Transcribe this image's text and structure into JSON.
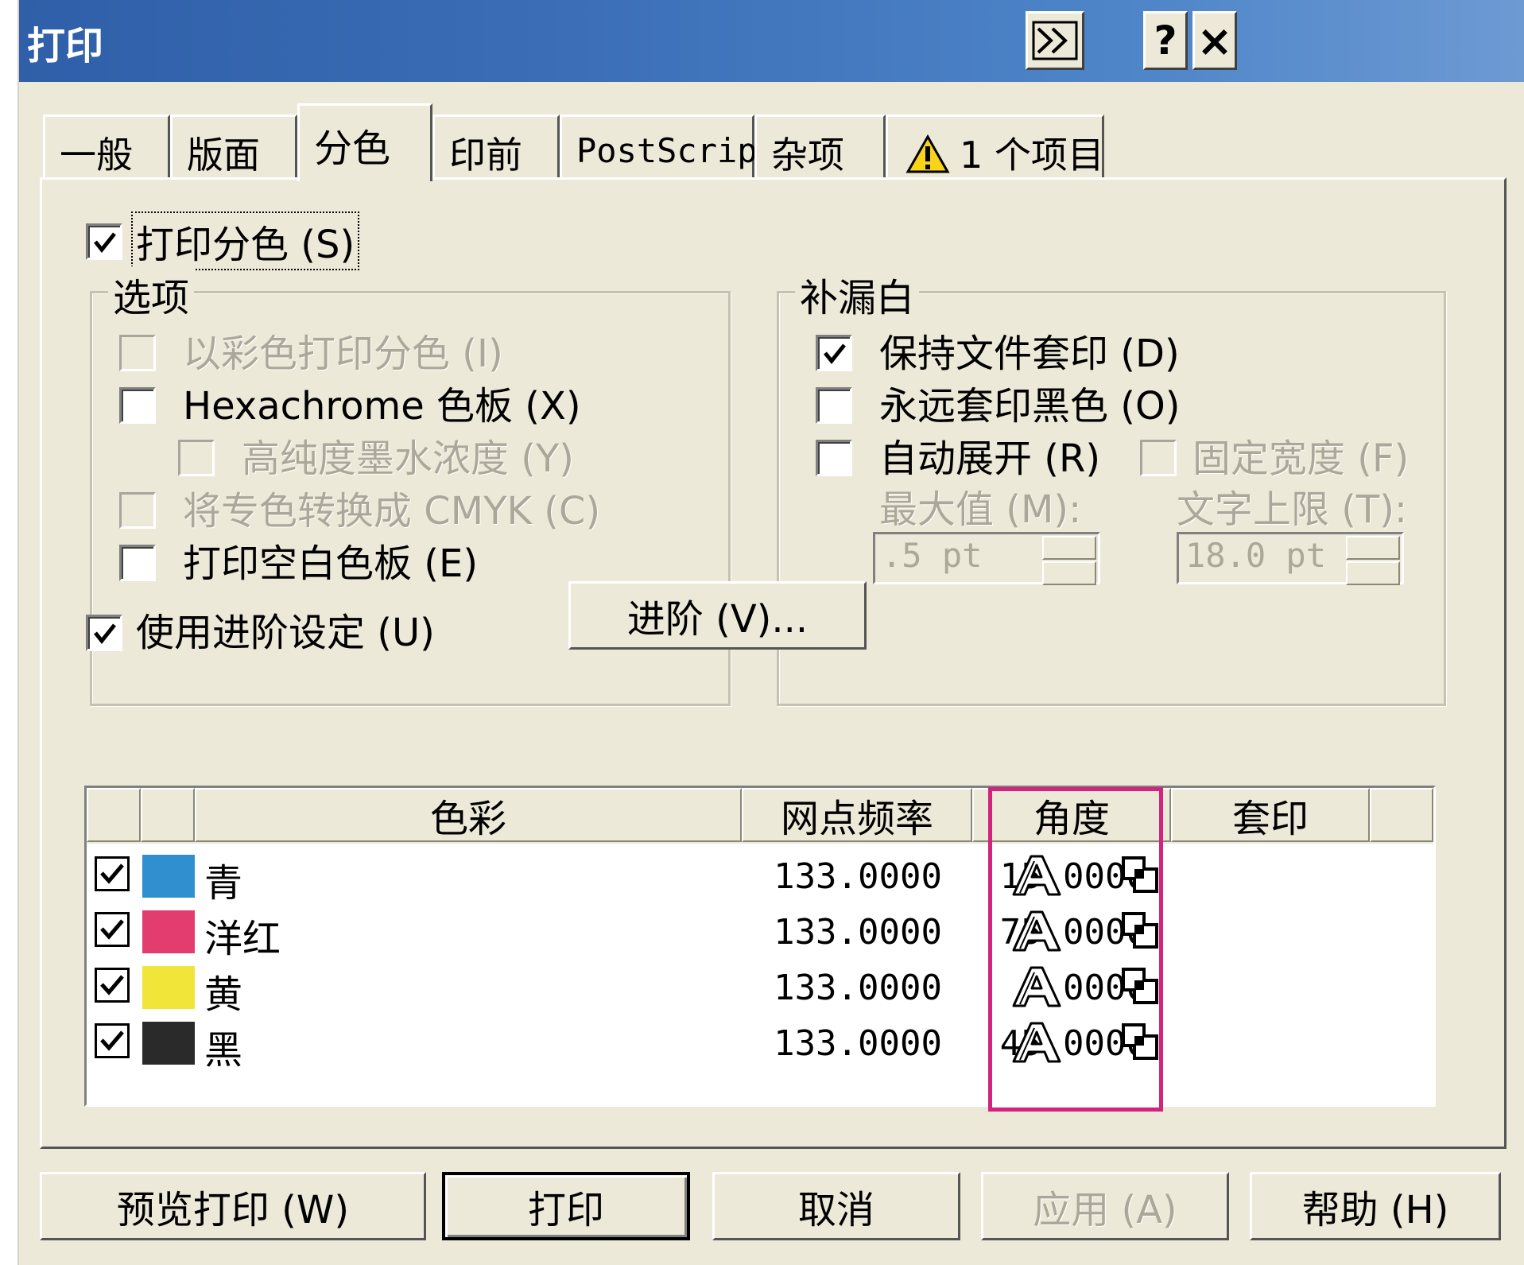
{
  "window": {
    "title": "打印"
  },
  "titlebar_buttons": {
    "expand": "expand-icon",
    "help": "?",
    "close": "×"
  },
  "tabs": [
    "一般",
    "版面",
    "分色",
    "印前",
    "PostScript",
    "杂项",
    "1 个项目"
  ],
  "active_tab": "分色",
  "print_separations": {
    "label": "打印分色 (S)",
    "checked": true
  },
  "options_group": {
    "title": "选项",
    "items": [
      {
        "label": "以彩色打印分色 (I)",
        "checked": false,
        "enabled": false
      },
      {
        "label": "Hexachrome 色板 (X)",
        "checked": false,
        "enabled": true
      },
      {
        "label": "高纯度墨水浓度 (Y)",
        "checked": false,
        "enabled": false
      },
      {
        "label": "将专色转换成 CMYK (C)",
        "checked": false,
        "enabled": false
      },
      {
        "label": "打印空白色板 (E)",
        "checked": false,
        "enabled": true
      }
    ]
  },
  "trap_group": {
    "title": "补漏白",
    "items": [
      {
        "label": "保持文件套印 (D)",
        "checked": true,
        "enabled": true
      },
      {
        "label": "永远套印黑色 (O)",
        "checked": false,
        "enabled": true
      },
      {
        "label": "自动展开 (R)",
        "checked": false,
        "enabled": true
      },
      {
        "label": "固定宽度 (F)",
        "checked": false,
        "enabled": false
      }
    ],
    "max_label": "最大值 (M):",
    "max_value": ".5 pt",
    "text_limit_label": "文字上限 (T):",
    "text_limit_value": "18.0 pt"
  },
  "advanced": {
    "checkbox_label": "使用进阶设定 (U)",
    "checked": true,
    "button_label": "进阶 (V)..."
  },
  "table": {
    "headers": [
      "色彩",
      "网点频率",
      "角度",
      "套印"
    ],
    "rows": [
      {
        "name": "青",
        "color": "#2f8fcf",
        "frequency": "133.0000",
        "angle": "15.0000",
        "checked": true
      },
      {
        "name": "洋红",
        "color": "#e23d6e",
        "frequency": "133.0000",
        "angle": "75.0000",
        "checked": true
      },
      {
        "name": "黄",
        "color": "#f2e53a",
        "frequency": "133.0000",
        "angle": ".0000",
        "checked": true
      },
      {
        "name": "黑",
        "color": "#2a2a2a",
        "frequency": "133.0000",
        "angle": "45.0000",
        "checked": true
      }
    ],
    "overprint_icons": [
      "text-overprint-icon",
      "graphic-overprint-icon"
    ]
  },
  "buttons": {
    "preview": "预览打印 (W)",
    "print": "打印",
    "cancel": "取消",
    "apply": "应用 (A)",
    "help": "帮助 (H)"
  },
  "colors": {
    "highlight": "#d2237e",
    "titlebar": "#3a6db6",
    "dialog_bg": "#ece9d8"
  }
}
